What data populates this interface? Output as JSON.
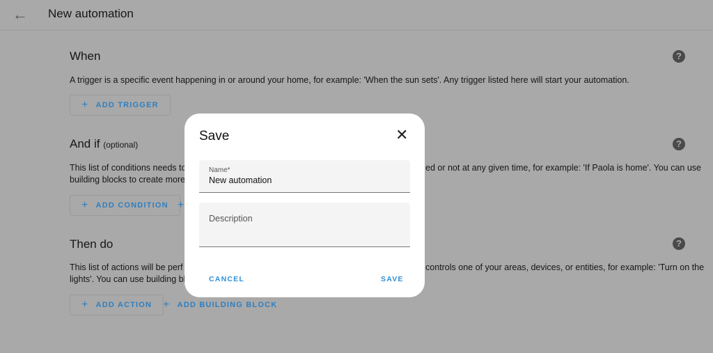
{
  "header": {
    "back_icon": "arrow-left-icon",
    "title": "New automation"
  },
  "when": {
    "title": "When",
    "desc": "A trigger is a specific event happening in or around your home, for example: 'When the sun sets'. Any trigger listed here will start your automation.",
    "button": "ADD TRIGGER"
  },
  "andif": {
    "title": "And if",
    "optional": "(optional)",
    "desc_left_1": "This list of conditions needs to",
    "desc_right_1": "ed or not at any given time, for example: 'If Paola is home'. You can use",
    "desc_left_2": "building blocks to create more",
    "button": "ADD CONDITION"
  },
  "thendo": {
    "title": "Then do",
    "desc_left_1": "This list of actions will be perf",
    "desc_right_1": "controls one of your areas, devices, or entities, for example: 'Turn on the",
    "desc_left_2": "lights'. You can use building blo",
    "button": "ADD ACTION",
    "button2": "ADD BUILDING BLOCK"
  },
  "dialog": {
    "title": "Save",
    "name_label": "Name*",
    "name_value": "New automation",
    "description_label": "Description",
    "cancel": "CANCEL",
    "save": "SAVE"
  },
  "colors": {
    "accent": "#2f7fc0",
    "scrim_background": "#a9a9a9"
  }
}
